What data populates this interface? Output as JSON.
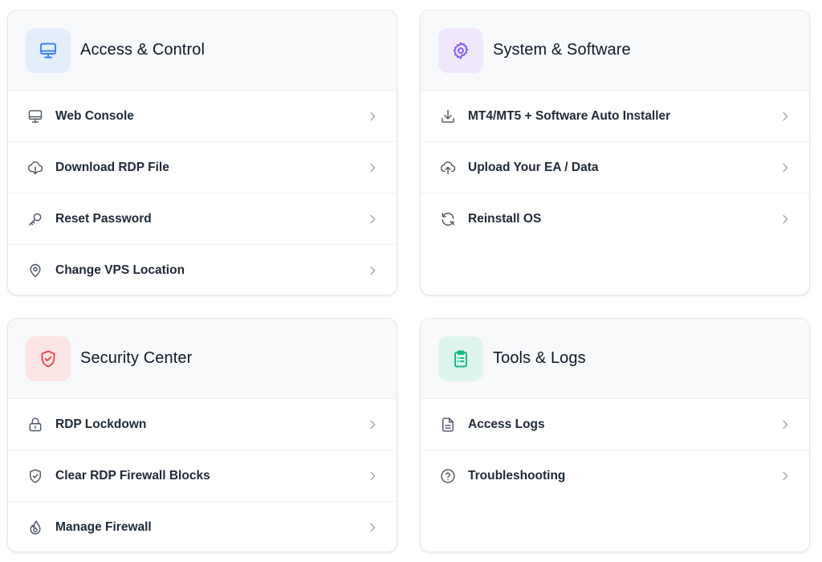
{
  "colors": {
    "access_accent": "#3b82f6",
    "access_bg": "#e4edfc",
    "system_accent": "#8b5cf6",
    "system_bg": "#efe8fd",
    "security_accent": "#ef4444",
    "security_bg": "#fbe5e5",
    "tools_accent": "#10b981",
    "tools_bg": "#def5ec",
    "row_icon": "#4b5563",
    "chevron": "#9ca3af"
  },
  "cards": [
    {
      "title": "Access & Control",
      "icon": "monitor-icon",
      "items": [
        {
          "label": "Web Console",
          "icon": "monitor-icon"
        },
        {
          "label": "Download RDP File",
          "icon": "cloud-download-icon"
        },
        {
          "label": "Reset Password",
          "icon": "key-icon"
        },
        {
          "label": "Change VPS Location",
          "icon": "map-pin-icon"
        }
      ]
    },
    {
      "title": "System & Software",
      "icon": "gear-icon",
      "items": [
        {
          "label": "MT4/MT5 + Software Auto Installer",
          "icon": "download-icon"
        },
        {
          "label": "Upload Your EA / Data",
          "icon": "cloud-upload-icon"
        },
        {
          "label": "Reinstall OS",
          "icon": "refresh-icon"
        }
      ]
    },
    {
      "title": "Security Center",
      "icon": "shield-check-icon",
      "items": [
        {
          "label": "RDP Lockdown",
          "icon": "lock-icon"
        },
        {
          "label": "Clear RDP Firewall Blocks",
          "icon": "shield-check-icon"
        },
        {
          "label": "Manage Firewall",
          "icon": "flame-icon"
        }
      ]
    },
    {
      "title": "Tools & Logs",
      "icon": "clipboard-list-icon",
      "items": [
        {
          "label": "Access Logs",
          "icon": "file-text-icon"
        },
        {
          "label": "Troubleshooting",
          "icon": "help-circle-icon"
        }
      ]
    }
  ]
}
